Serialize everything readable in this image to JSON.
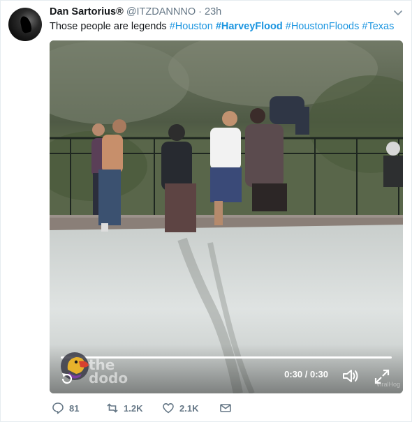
{
  "tweet": {
    "display_name": "Dan Sartorius",
    "verified_mark": "®",
    "handle": "@ITZDANNNO",
    "separator": "·",
    "time": "23h",
    "text_plain": "Those people are legends",
    "hashtags": [
      "#Houston",
      "#HarveyFlood",
      "#HoustonFloods",
      "#Texas"
    ]
  },
  "video": {
    "timecode": "0:30 / 0:30",
    "progress": 1.0,
    "watermark_line1": "the",
    "watermark_line2": "dodo",
    "credit": "ViralHog"
  },
  "actions": {
    "replies": "81",
    "retweets": "1.2K",
    "likes": "2.1K"
  },
  "icons": {
    "reply": "reply-icon",
    "retweet": "retweet-icon",
    "like": "heart-icon",
    "dm": "envelope-icon",
    "caret": "chevron-down-icon",
    "volume": "volume-icon",
    "fullscreen": "fullscreen-icon",
    "replay": "replay-icon"
  },
  "colors": {
    "link": "#1b95e0",
    "muted": "#657786",
    "text": "#14171a"
  }
}
